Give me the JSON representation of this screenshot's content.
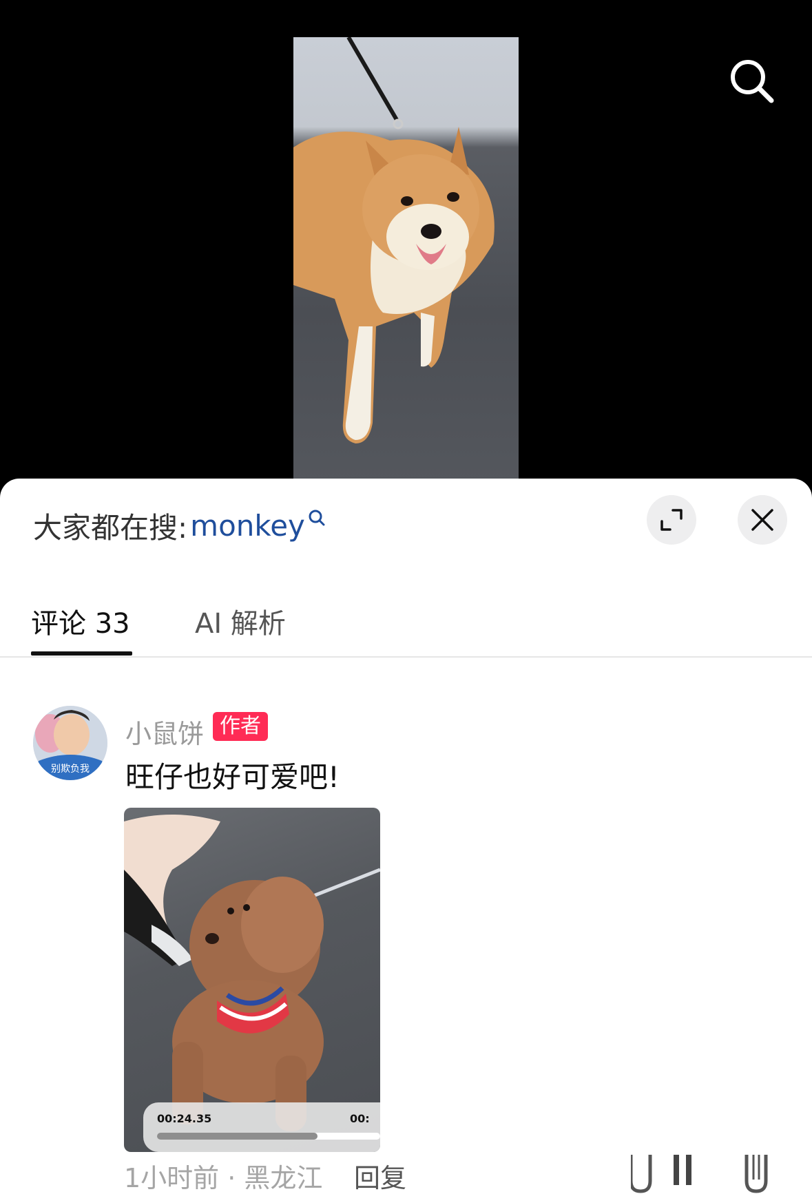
{
  "video": {
    "search_icon": "search-icon"
  },
  "sheet": {
    "hot_search_prefix": "大家都在搜:",
    "hot_search_keyword": "monkey",
    "expand_icon": "expand-icon",
    "close_icon": "close-icon",
    "tabs": [
      {
        "label": "评论 33",
        "active": true
      },
      {
        "label": "AI 解析",
        "active": false
      }
    ]
  },
  "comment": {
    "author": "小鼠饼",
    "badge": "作者",
    "avatar_caption": "别欺负我",
    "text": "旺仔也好可爱吧!",
    "media": {
      "time_current": "00:24.35",
      "time_next": "00:",
      "progress": 0.72
    },
    "meta": "1小时前 · 黑龙江",
    "reply_label": "回复"
  },
  "colors": {
    "badge": "#ff2b55",
    "keyword": "#1f4e9c"
  }
}
